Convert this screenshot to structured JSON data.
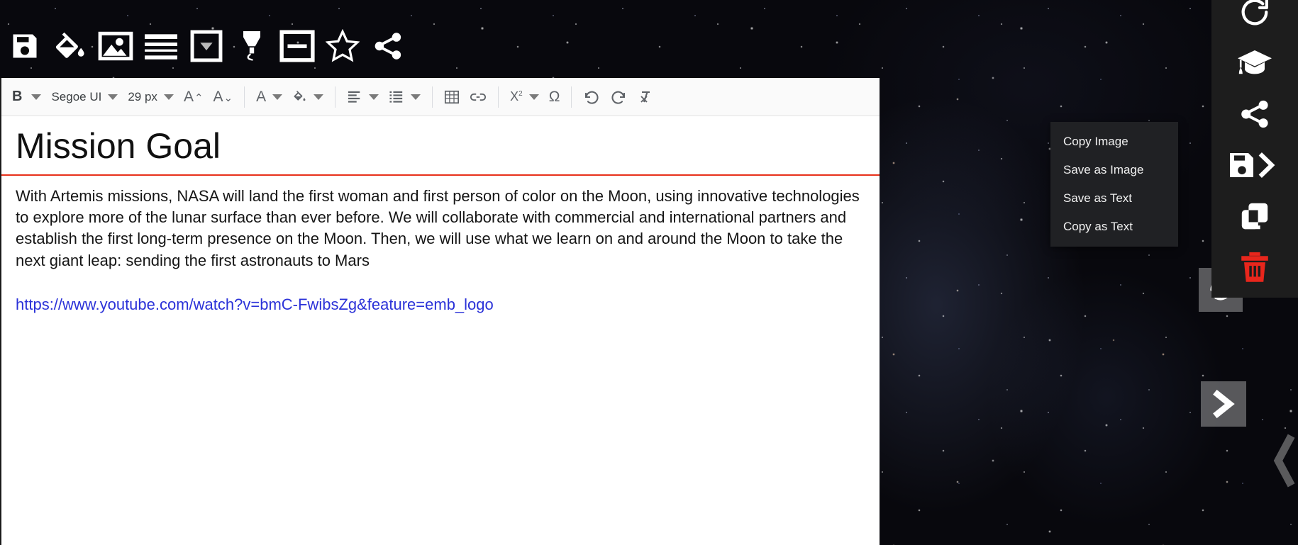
{
  "background": {
    "description": "starfield-image",
    "base_color": "#08080d"
  },
  "top_icon_bar": {
    "icons": [
      {
        "name": "save-icon",
        "label": "Save"
      },
      {
        "name": "paint-bucket-icon",
        "label": "Fill Color"
      },
      {
        "name": "image-icon",
        "label": "Insert Image"
      },
      {
        "name": "lines-icon",
        "label": "Line Style"
      },
      {
        "name": "shape-fill-icon",
        "label": "Shape Fill"
      },
      {
        "name": "highlighter-icon",
        "label": "Highlighter"
      },
      {
        "name": "text-box-icon",
        "label": "Text Box"
      },
      {
        "name": "star-icon",
        "label": "Favorite"
      },
      {
        "name": "share-icon",
        "label": "Share"
      }
    ]
  },
  "format_toolbar": {
    "bold_label": "B",
    "font_family": "Segoe UI",
    "font_size": "29 px",
    "increase_font_label": "A",
    "increase_font_chevron": "⌃",
    "decrease_font_label": "A",
    "decrease_font_chevron": "⌄",
    "text_color_label": "A",
    "omega_label": "Ω",
    "superscript_label": "X",
    "superscript_exponent": "2",
    "items": [
      {
        "name": "bold-button",
        "label": "B"
      },
      {
        "name": "font-family-select",
        "label": "Segoe UI"
      },
      {
        "name": "font-size-select",
        "label": "29 px"
      },
      {
        "name": "increase-font-button",
        "label": "A⌃"
      },
      {
        "name": "decrease-font-button",
        "label": "A⌄"
      },
      {
        "name": "text-color-button",
        "label": "A"
      },
      {
        "name": "highlight-color-button",
        "label": "fill"
      },
      {
        "name": "align-button",
        "label": "align"
      },
      {
        "name": "list-button",
        "label": "list"
      },
      {
        "name": "insert-table-button",
        "label": "table"
      },
      {
        "name": "insert-link-button",
        "label": "link"
      },
      {
        "name": "superscript-button",
        "label": "X2"
      },
      {
        "name": "special-character-button",
        "label": "Ω"
      },
      {
        "name": "undo-button",
        "label": "undo"
      },
      {
        "name": "redo-button",
        "label": "redo"
      },
      {
        "name": "clear-formatting-button",
        "label": "clear formatting"
      }
    ]
  },
  "document": {
    "heading": "Mission Goal",
    "rule_color": "#e8301b",
    "paragraph": "With Artemis missions, NASA will land the first woman and first person of color on the Moon, using innovative technologies to explore more of the lunar surface than ever before. We will collaborate with commercial and international partners and establish the first long-term presence on the Moon. Then, we will use what we learn on and around the Moon to take the next giant leap: sending the first astronauts to Mars",
    "link_text": "https://www.youtube.com/watch?v=bmC-FwibsZg&feature=emb_logo",
    "link_color": "#2b32d8"
  },
  "context_menu": {
    "background": "#202124",
    "items": [
      {
        "name": "menu-copy-image",
        "label": "Copy Image"
      },
      {
        "name": "menu-save-image",
        "label": "Save as Image"
      },
      {
        "name": "menu-save-text",
        "label": "Save as Text"
      },
      {
        "name": "menu-copy-text",
        "label": "Copy as Text"
      }
    ]
  },
  "right_rail": {
    "background": "#1d1d1d",
    "delete_color": "#e8261c",
    "items": [
      {
        "name": "rotate-refresh-icon",
        "label": "Refresh"
      },
      {
        "name": "graduation-cap-icon",
        "label": "Learn"
      },
      {
        "name": "share-icon",
        "label": "Share"
      },
      {
        "name": "save-next-icon",
        "label": "Save and Continue"
      },
      {
        "name": "duplicate-icon",
        "label": "Duplicate"
      },
      {
        "name": "trash-icon",
        "label": "Delete"
      }
    ]
  },
  "floating_buttons": [
    {
      "name": "rotate-button",
      "label": "Rotate"
    },
    {
      "name": "next-chevron-button",
      "label": "Next"
    },
    {
      "name": "back-chevron-button",
      "label": "Back"
    }
  ]
}
